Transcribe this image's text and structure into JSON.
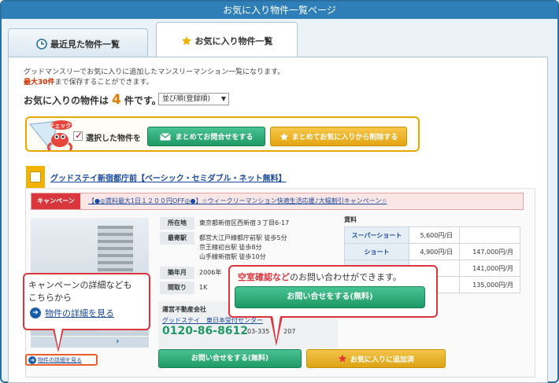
{
  "title": "お気に入り物件一覧ページ",
  "tabs": [
    {
      "label": "最近見た物件一覧",
      "icon": "clock-icon"
    },
    {
      "label": "お気に入り物件一覧",
      "icon": "star-icon"
    }
  ],
  "intro": {
    "line1": "グッドマンスリーでお気に入りに追加したマンスリーマンション一覧になります。",
    "max_label": "最大30件",
    "line2_rest": "まで保存することができます。",
    "count_prefix": "お気に入りの物件は",
    "count": "4",
    "count_suffix": "件です。"
  },
  "sort": {
    "selected": "並び順(登録順)"
  },
  "actions": {
    "selected_label": "選択した物件を",
    "bulk_contact": "まとめてお問合せをする",
    "bulk_remove": "まとめてお気に入りから削除する",
    "mascot_badge": "チェック!"
  },
  "property": {
    "name": "グッドステイ新宿都庁前【ベーシック・セミダブル・ネット無料】",
    "campaign_badge": "キャンペーン",
    "campaign_text": "【●◎賃料最大1日１２００円OFF◎●】☆ウィークリーマンション快適生活応援♪大幅割引キャンペーン☆",
    "address_label": "所在地",
    "address": "東京都新宿区西新宿３丁目6-17",
    "station_label": "最寄駅",
    "stations": [
      "都営大江戸線都庁前駅 徒歩5分",
      "京王線初台駅 徒歩8分",
      "山手線新宿駅 徒歩10分"
    ],
    "built_label": "築年月",
    "built": "2006年",
    "layout_label": "間取り",
    "layout": "1K",
    "agent_label": "運営不動産会社",
    "agent_name": "グッドステイ　東日本受付センター",
    "agent_phone": "0120-86-8612",
    "agent_phone2": "03-335",
    "agent_phone2_tail": "207",
    "rent_label": "賃料",
    "rent": [
      {
        "plan": "スーパーショート",
        "daily": "5,600円/日",
        "monthly": ""
      },
      {
        "plan": "ショート",
        "daily": "4,900円/日",
        "monthly": "147,000円/月"
      },
      {
        "plan": "",
        "daily": "",
        "monthly": "141,000円/月"
      },
      {
        "plan": "",
        "daily": "",
        "monthly": "135,000円/月"
      }
    ],
    "contact_button": "お問い合せをする(無料)",
    "fav_button": "お気に入りに追加済",
    "detail_link": "物件の詳細を見る"
  },
  "callouts": {
    "campaign_line1": "キャンペーンの詳細なども",
    "campaign_line2": "こちらから",
    "campaign_link": "物件の詳細を見る",
    "inquiry_red": "空室確認など",
    "inquiry_rest": "のお問い合わせができます。",
    "inquiry_button": "お問い合せをする(無料)"
  },
  "colors": {
    "brand_blue": "#2e7fb8",
    "green": "#1f9a66",
    "gold": "#e3a512",
    "red": "#d9363e"
  }
}
